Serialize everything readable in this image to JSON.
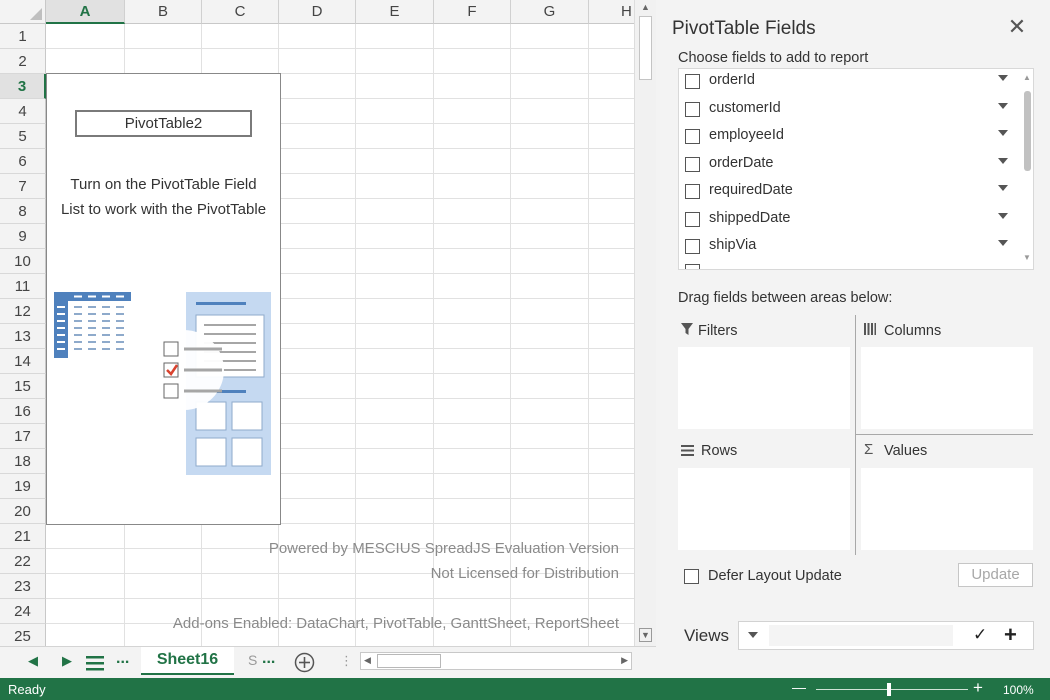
{
  "sheet": {
    "columns": [
      "A",
      "B",
      "C",
      "D",
      "E",
      "F",
      "G",
      "H"
    ],
    "selected_column": "A",
    "rows": [
      "1",
      "2",
      "3",
      "4",
      "5",
      "6",
      "7",
      "8",
      "9",
      "10",
      "11",
      "12",
      "13",
      "14",
      "15",
      "16",
      "17",
      "18",
      "19",
      "20",
      "21",
      "22",
      "23",
      "24",
      "25"
    ],
    "selected_row": "3"
  },
  "pivot_placeholder": {
    "name": "PivotTable2",
    "line1": "Turn on the PivotTable Field",
    "line2": "List to work with the PivotTable"
  },
  "watermark": {
    "line1": "Powered by MESCIUS SpreadJS Evaluation Version",
    "line2": "Not Licensed for Distribution",
    "line3": "Add-ons Enabled: DataChart, PivotTable, GanttSheet, ReportSheet"
  },
  "tabs": {
    "active": "Sheet16",
    "next_partial": "S",
    "ellipsis": "..."
  },
  "status": {
    "text": "Ready",
    "zoom": "100%",
    "zoom_minus": "—",
    "zoom_plus": "+"
  },
  "panel": {
    "title": "PivotTable Fields",
    "choose_label": "Choose fields to add to report",
    "fields": [
      "orderId",
      "customerId",
      "employeeId",
      "orderDate",
      "requiredDate",
      "shippedDate",
      "shipVia"
    ],
    "drag_label": "Drag fields between areas below:",
    "zones": {
      "filters": "Filters",
      "columns": "Columns",
      "rows": "Rows",
      "values": "Values"
    },
    "defer_label": "Defer Layout Update",
    "update_label": "Update",
    "views_label": "Views"
  },
  "colors": {
    "accent": "#217346",
    "pivot_blue": "#4f81bd",
    "pivot_light_blue": "#c5d9f1"
  }
}
